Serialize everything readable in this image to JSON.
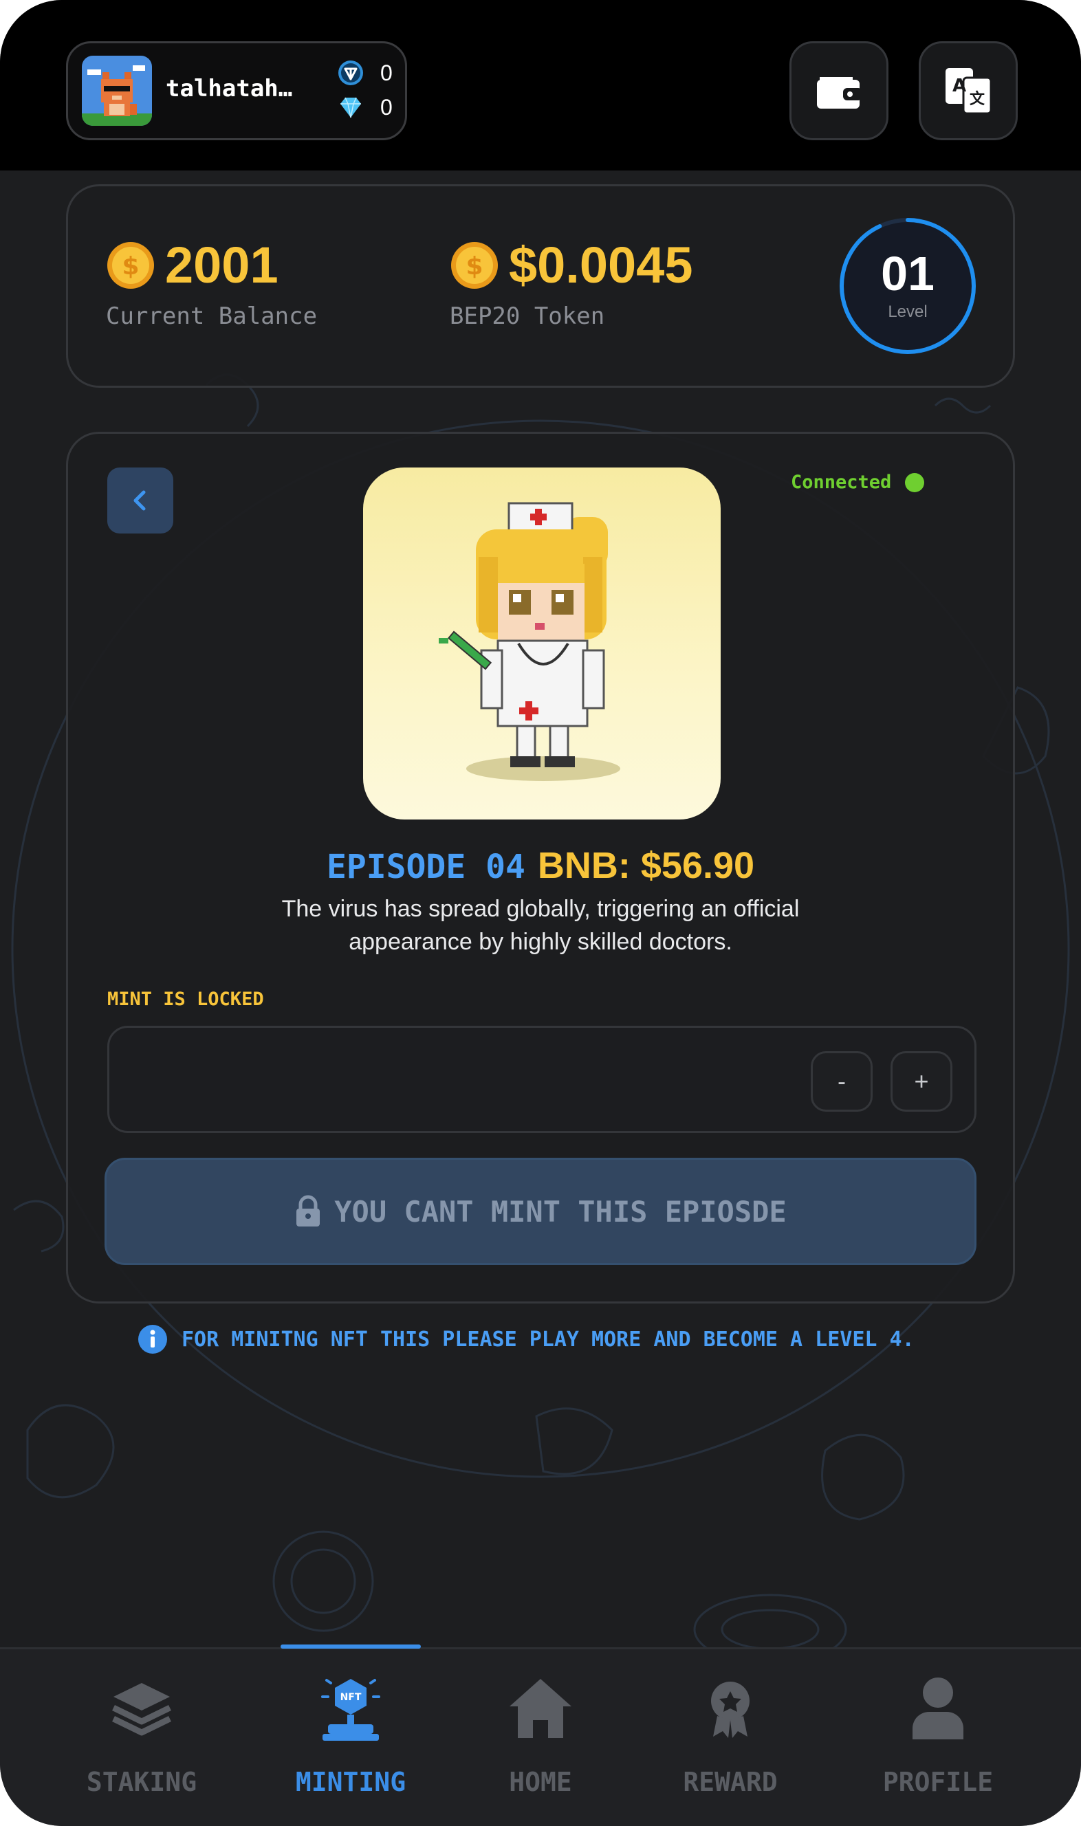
{
  "header": {
    "username": "talhatahir...",
    "ton_balance": "0",
    "gem_balance": "0"
  },
  "stats": {
    "current_balance": "2001",
    "current_balance_label": "Current Balance",
    "token_price": "$0.0045",
    "token_label": "BEP20 Token",
    "level": "01",
    "level_label": "Level",
    "level_progress": 0.93
  },
  "episode": {
    "status": "Connected",
    "name": "EPISODE 04",
    "price": "BNB: $56.90",
    "description_line1": "The virus has spread globally, triggering an official",
    "description_line2": "appearance by highly  skilled doctors.",
    "mint_status": "MINT IS LOCKED",
    "decrement": "-",
    "increment": "+",
    "mint_button": "YOU CANT MINT THIS EPIOSDE",
    "info": "FOR  MINITNG NFT THIS PLEASE PLAY MORE AND BECOME A LEVEL 4."
  },
  "nav": {
    "items": [
      {
        "label": "STAKING",
        "icon": "layers-icon"
      },
      {
        "label": "MINTING",
        "icon": "nft-mint-icon"
      },
      {
        "label": "HOME",
        "icon": "home-icon"
      },
      {
        "label": "REWARD",
        "icon": "reward-medal-icon"
      },
      {
        "label": "PROFILE",
        "icon": "user-icon"
      }
    ],
    "active": "MINTING"
  },
  "colors": {
    "accent_blue": "#3b8ee8",
    "gold": "#f8c43a",
    "connected_green": "#6fcf30",
    "background": "#1d1e20"
  }
}
